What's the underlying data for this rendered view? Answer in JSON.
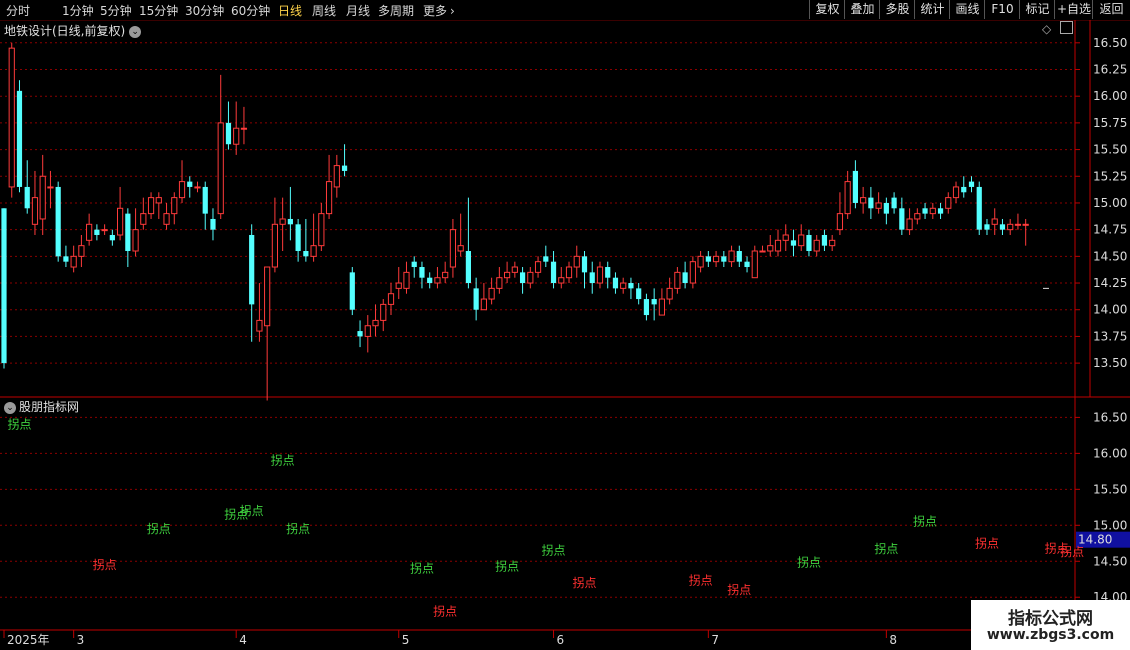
{
  "toolbar": {
    "timeframes": [
      "分时",
      "1分钟",
      "5分钟",
      "15分钟",
      "30分钟",
      "60分钟",
      "日线",
      "周线",
      "月线",
      "多周期",
      "更多"
    ],
    "active_timeframe": "日线",
    "buttons": [
      "复权",
      "叠加",
      "多股",
      "统计",
      "画线",
      "F10",
      "标记",
      "+自选",
      "返回"
    ]
  },
  "main_panel": {
    "title": "地铁设计(日线,前复权)"
  },
  "indicator_panel": {
    "title": "股朋指标网"
  },
  "watermark": {
    "line1": "指标公式网",
    "line2": "www.zbgs3.com"
  },
  "colors": {
    "up": "#ff3b3b",
    "down": "#54ffff",
    "grid": "#8c0000",
    "buy": "#3fd23f",
    "sell": "#ff3030",
    "axis": "#c00000"
  },
  "chart_data": [
    {
      "type": "candlestick",
      "yticks": [
        13.5,
        13.75,
        14.0,
        14.25,
        14.5,
        14.75,
        15.0,
        15.25,
        15.5,
        15.75,
        16.0,
        16.25,
        16.5
      ],
      "ylim": [
        13.22,
        16.62
      ],
      "x_labels": [
        {
          "label": "2025年",
          "index": 0
        },
        {
          "label": "3",
          "index": 9
        },
        {
          "label": "4",
          "index": 30
        },
        {
          "label": "5",
          "index": 51
        },
        {
          "label": "6",
          "index": 71
        },
        {
          "label": "7",
          "index": 91
        },
        {
          "label": "8",
          "index": 114
        }
      ],
      "candles": [
        [
          14.95,
          13.5,
          14.95,
          13.45
        ],
        [
          15.15,
          16.45,
          16.5,
          15.05
        ],
        [
          16.05,
          15.15,
          16.15,
          15.1
        ],
        [
          15.15,
          14.95,
          15.4,
          14.9
        ],
        [
          14.8,
          15.05,
          15.3,
          14.7
        ],
        [
          14.85,
          15.25,
          15.45,
          14.7
        ],
        [
          15.15,
          15.15,
          15.3,
          14.95
        ],
        [
          15.15,
          14.5,
          15.2,
          14.45
        ],
        [
          14.5,
          14.45,
          14.6,
          14.4
        ],
        [
          14.4,
          14.5,
          14.6,
          14.35
        ],
        [
          14.5,
          14.6,
          14.7,
          14.4
        ],
        [
          14.65,
          14.8,
          14.9,
          14.6
        ],
        [
          14.75,
          14.7,
          14.8,
          14.65
        ],
        [
          14.75,
          14.75,
          14.8,
          14.7
        ],
        [
          14.7,
          14.65,
          14.75,
          14.6
        ],
        [
          14.7,
          14.95,
          15.15,
          14.65
        ],
        [
          14.9,
          14.55,
          14.95,
          14.4
        ],
        [
          14.55,
          14.75,
          14.95,
          14.5
        ],
        [
          14.8,
          14.9,
          15.05,
          14.75
        ],
        [
          14.9,
          15.05,
          15.1,
          14.85
        ],
        [
          15.0,
          15.05,
          15.1,
          14.85
        ],
        [
          14.8,
          14.9,
          15.0,
          14.75
        ],
        [
          14.9,
          15.05,
          15.1,
          14.8
        ],
        [
          15.05,
          15.2,
          15.4,
          15.0
        ],
        [
          15.2,
          15.15,
          15.25,
          15.05
        ],
        [
          15.15,
          15.15,
          15.2,
          15.1
        ],
        [
          15.15,
          14.9,
          15.2,
          14.75
        ],
        [
          14.85,
          14.75,
          14.95,
          14.65
        ],
        [
          14.9,
          15.75,
          16.2,
          14.85
        ],
        [
          15.75,
          15.55,
          15.95,
          15.5
        ],
        [
          15.55,
          15.7,
          15.95,
          15.45
        ],
        [
          15.7,
          15.7,
          15.9,
          15.55
        ],
        [
          14.7,
          14.05,
          14.8,
          13.7
        ],
        [
          13.8,
          13.9,
          14.25,
          13.7
        ],
        [
          13.85,
          14.4,
          14.4,
          13.15
        ],
        [
          14.4,
          14.8,
          15.05,
          14.35
        ],
        [
          14.8,
          14.85,
          15.05,
          14.55
        ],
        [
          14.85,
          14.8,
          15.15,
          14.65
        ],
        [
          14.8,
          14.55,
          14.85,
          14.45
        ],
        [
          14.55,
          14.5,
          14.85,
          14.45
        ],
        [
          14.5,
          14.6,
          14.9,
          14.45
        ],
        [
          14.6,
          14.9,
          15.0,
          14.55
        ],
        [
          14.9,
          15.2,
          15.45,
          14.85
        ],
        [
          15.15,
          15.35,
          15.45,
          15.05
        ],
        [
          15.35,
          15.3,
          15.55,
          15.25
        ],
        [
          14.35,
          14.0,
          14.4,
          13.95
        ],
        [
          13.8,
          13.75,
          13.9,
          13.65
        ],
        [
          13.75,
          13.85,
          13.95,
          13.6
        ],
        [
          13.85,
          13.9,
          14.05,
          13.75
        ],
        [
          13.9,
          14.05,
          14.1,
          13.8
        ],
        [
          14.05,
          14.15,
          14.25,
          13.95
        ],
        [
          14.2,
          14.25,
          14.4,
          14.1
        ],
        [
          14.2,
          14.35,
          14.45,
          14.15
        ],
        [
          14.45,
          14.4,
          14.5,
          14.3
        ],
        [
          14.4,
          14.3,
          14.45,
          14.2
        ],
        [
          14.3,
          14.25,
          14.35,
          14.2
        ],
        [
          14.25,
          14.3,
          14.4,
          14.2
        ],
        [
          14.3,
          14.35,
          14.45,
          14.25
        ],
        [
          14.4,
          14.75,
          14.85,
          14.3
        ],
        [
          14.55,
          14.6,
          14.9,
          14.5
        ],
        [
          14.55,
          14.25,
          15.05,
          14.2
        ],
        [
          14.2,
          14.0,
          14.3,
          13.9
        ],
        [
          14.0,
          14.1,
          14.25,
          14.0
        ],
        [
          14.1,
          14.2,
          14.3,
          14.05
        ],
        [
          14.2,
          14.3,
          14.4,
          14.15
        ],
        [
          14.3,
          14.35,
          14.45,
          14.25
        ],
        [
          14.35,
          14.4,
          14.45,
          14.3
        ],
        [
          14.35,
          14.25,
          14.4,
          14.15
        ],
        [
          14.25,
          14.35,
          14.4,
          14.2
        ],
        [
          14.35,
          14.45,
          14.5,
          14.3
        ],
        [
          14.5,
          14.45,
          14.6,
          14.4
        ],
        [
          14.45,
          14.25,
          14.55,
          14.2
        ],
        [
          14.25,
          14.3,
          14.4,
          14.2
        ],
        [
          14.3,
          14.4,
          14.45,
          14.25
        ],
        [
          14.4,
          14.5,
          14.6,
          14.3
        ],
        [
          14.5,
          14.35,
          14.55,
          14.2
        ],
        [
          14.35,
          14.25,
          14.45,
          14.15
        ],
        [
          14.25,
          14.4,
          14.45,
          14.2
        ],
        [
          14.4,
          14.3,
          14.45,
          14.2
        ],
        [
          14.3,
          14.2,
          14.35,
          14.15
        ],
        [
          14.2,
          14.25,
          14.3,
          14.15
        ],
        [
          14.25,
          14.2,
          14.3,
          14.1
        ],
        [
          14.2,
          14.1,
          14.25,
          14.05
        ],
        [
          14.1,
          13.95,
          14.15,
          13.9
        ],
        [
          14.1,
          14.05,
          14.2,
          13.9
        ],
        [
          13.95,
          14.1,
          14.2,
          13.95
        ],
        [
          14.1,
          14.2,
          14.3,
          14.05
        ],
        [
          14.2,
          14.35,
          14.4,
          14.15
        ],
        [
          14.35,
          14.25,
          14.45,
          14.2
        ],
        [
          14.25,
          14.45,
          14.5,
          14.2
        ],
        [
          14.4,
          14.5,
          14.55,
          14.35
        ],
        [
          14.5,
          14.45,
          14.55,
          14.4
        ],
        [
          14.45,
          14.5,
          14.55,
          14.4
        ],
        [
          14.5,
          14.45,
          14.55,
          14.4
        ],
        [
          14.45,
          14.55,
          14.6,
          14.4
        ],
        [
          14.55,
          14.45,
          14.6,
          14.4
        ],
        [
          14.45,
          14.4,
          14.5,
          14.35
        ],
        [
          14.3,
          14.55,
          14.6,
          14.3
        ],
        [
          14.55,
          14.55,
          14.6,
          14.55
        ],
        [
          14.55,
          14.6,
          14.7,
          14.5
        ],
        [
          14.55,
          14.65,
          14.75,
          14.5
        ],
        [
          14.65,
          14.7,
          14.8,
          14.55
        ],
        [
          14.65,
          14.6,
          14.75,
          14.5
        ],
        [
          14.6,
          14.7,
          14.8,
          14.55
        ],
        [
          14.7,
          14.55,
          14.75,
          14.5
        ],
        [
          14.55,
          14.65,
          14.7,
          14.5
        ],
        [
          14.7,
          14.6,
          14.75,
          14.55
        ],
        [
          14.6,
          14.65,
          14.7,
          14.55
        ],
        [
          14.75,
          14.9,
          15.1,
          14.7
        ],
        [
          14.9,
          15.2,
          15.3,
          14.85
        ],
        [
          15.3,
          15.0,
          15.4,
          14.95
        ],
        [
          15.0,
          15.05,
          15.15,
          14.9
        ],
        [
          15.05,
          14.95,
          15.15,
          14.85
        ],
        [
          14.95,
          15.0,
          15.1,
          14.9
        ],
        [
          15.0,
          14.9,
          15.05,
          14.8
        ],
        [
          15.05,
          14.95,
          15.1,
          14.9
        ],
        [
          14.95,
          14.75,
          15.05,
          14.7
        ],
        [
          14.75,
          14.85,
          14.95,
          14.7
        ],
        [
          14.85,
          14.9,
          14.95,
          14.8
        ],
        [
          14.95,
          14.9,
          15.0,
          14.85
        ],
        [
          14.9,
          14.95,
          15.0,
          14.85
        ],
        [
          14.95,
          14.9,
          15.0,
          14.85
        ],
        [
          14.95,
          15.05,
          15.1,
          14.9
        ],
        [
          15.05,
          15.15,
          15.2,
          15.0
        ],
        [
          15.15,
          15.1,
          15.25,
          15.05
        ],
        [
          15.2,
          15.15,
          15.25,
          15.1
        ],
        [
          15.15,
          14.75,
          15.2,
          14.7
        ],
        [
          14.8,
          14.75,
          14.85,
          14.7
        ],
        [
          14.8,
          14.85,
          14.95,
          14.7
        ],
        [
          14.8,
          14.75,
          14.85,
          14.7
        ],
        [
          14.75,
          14.8,
          14.85,
          14.7
        ],
        [
          14.8,
          14.8,
          14.9,
          14.75
        ],
        [
          14.8,
          14.8,
          14.85,
          14.6
        ]
      ]
    },
    {
      "type": "scatter",
      "title": "股朋指标网",
      "yticks": [
        14.0,
        14.5,
        15.0,
        15.5,
        16.0,
        16.5
      ],
      "ylim": [
        13.6,
        16.7
      ],
      "current_value": 14.8,
      "signals": [
        {
          "text": "拐点",
          "color": "buy",
          "index": 2,
          "value": 16.4
        },
        {
          "text": "拐点",
          "color": "sell",
          "index": 13,
          "value": 14.45
        },
        {
          "text": "拐点",
          "color": "buy",
          "index": 20,
          "value": 14.95
        },
        {
          "text": "拐点",
          "color": "buy",
          "index": 30,
          "value": 15.15
        },
        {
          "text": "拐点",
          "color": "buy",
          "index": 32,
          "value": 15.2
        },
        {
          "text": "拐点",
          "color": "buy",
          "index": 36,
          "value": 15.9
        },
        {
          "text": "拐点",
          "color": "buy",
          "index": 38,
          "value": 14.95
        },
        {
          "text": "拐点",
          "color": "buy",
          "index": 54,
          "value": 14.4
        },
        {
          "text": "拐点",
          "color": "sell",
          "index": 57,
          "value": 13.8
        },
        {
          "text": "拐点",
          "color": "buy",
          "index": 65,
          "value": 14.43
        },
        {
          "text": "拐点",
          "color": "buy",
          "index": 71,
          "value": 14.65
        },
        {
          "text": "拐点",
          "color": "sell",
          "index": 75,
          "value": 14.2
        },
        {
          "text": "拐点",
          "color": "sell",
          "index": 90,
          "value": 14.23
        },
        {
          "text": "拐点",
          "color": "sell",
          "index": 95,
          "value": 14.1
        },
        {
          "text": "拐点",
          "color": "buy",
          "index": 104,
          "value": 14.48
        },
        {
          "text": "拐点",
          "color": "buy",
          "index": 114,
          "value": 14.67
        },
        {
          "text": "拐点",
          "color": "buy",
          "index": 119,
          "value": 15.05
        },
        {
          "text": "拐点",
          "color": "sell",
          "index": 127,
          "value": 14.75
        },
        {
          "text": "拐点",
          "color": "sell",
          "index": 136,
          "value": 14.68
        },
        {
          "text": "拐点",
          "color": "sell",
          "index": 138,
          "value": 14.63
        }
      ]
    }
  ]
}
